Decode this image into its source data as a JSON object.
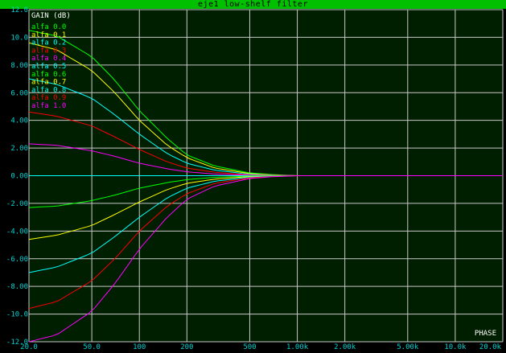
{
  "window": {
    "title": "eje1 low-shelf filter"
  },
  "chart_data": {
    "type": "line",
    "title": "eje1 low-shelf filter",
    "ylabel": "GAIN (dB)",
    "corner_label": "PHASE",
    "x_scale": "log",
    "xlim": [
      20,
      20000
    ],
    "ylim": [
      -12,
      12
    ],
    "grid": true,
    "legend_placement": "top-left",
    "x_ticks": [
      {
        "v": 20,
        "label": "20.0"
      },
      {
        "v": 50,
        "label": "50.0"
      },
      {
        "v": 100,
        "label": "100"
      },
      {
        "v": 200,
        "label": "200"
      },
      {
        "v": 500,
        "label": "500"
      },
      {
        "v": 1000,
        "label": "1.00k"
      },
      {
        "v": 2000,
        "label": "2.00k"
      },
      {
        "v": 5000,
        "label": "5.00k"
      },
      {
        "v": 10000,
        "label": "10.0k"
      },
      {
        "v": 20000,
        "label": "20.0k"
      }
    ],
    "y_ticks": [
      {
        "v": 12,
        "label": "12.0"
      },
      {
        "v": 10,
        "label": "10.0"
      },
      {
        "v": 8,
        "label": "8.00"
      },
      {
        "v": 6,
        "label": "6.00"
      },
      {
        "v": 4,
        "label": "4.00"
      },
      {
        "v": 2,
        "label": "2.00"
      },
      {
        "v": 0,
        "label": "0.00"
      },
      {
        "v": -2,
        "label": "-2.00"
      },
      {
        "v": -4,
        "label": "-4.00"
      },
      {
        "v": -6,
        "label": "-6.00"
      },
      {
        "v": -8,
        "label": "-8.00"
      },
      {
        "v": -10,
        "label": "-10.0"
      },
      {
        "v": -12,
        "label": "-12.0"
      }
    ],
    "x": [
      20,
      30,
      50,
      70,
      100,
      150,
      200,
      300,
      500,
      700,
      1000,
      2000,
      5000,
      10000,
      20000
    ],
    "series": [
      {
        "name": "alfa 0.0",
        "color": "#00ff00",
        "values": [
          10.5,
          10.1,
          8.6,
          6.9,
          4.7,
          2.7,
          1.5,
          0.7,
          0.2,
          0.08,
          0,
          0,
          0,
          0,
          0
        ]
      },
      {
        "name": "alfa 0.1",
        "color": "#ffff00",
        "values": [
          9.6,
          9.1,
          7.6,
          6.0,
          4.0,
          2.2,
          1.3,
          0.55,
          0.15,
          0.05,
          0,
          0,
          0,
          0,
          0
        ]
      },
      {
        "name": "alfa 0.2",
        "color": "#00ffff",
        "values": [
          7.0,
          6.6,
          5.6,
          4.4,
          3.0,
          1.6,
          0.9,
          0.4,
          0.1,
          0.03,
          0,
          0,
          0,
          0,
          0
        ]
      },
      {
        "name": "alfa 0.3",
        "color": "#ff0000",
        "values": [
          4.6,
          4.3,
          3.6,
          2.8,
          1.9,
          1.0,
          0.55,
          0.25,
          0.06,
          0.02,
          0,
          0,
          0,
          0,
          0
        ]
      },
      {
        "name": "alfa 0.4",
        "color": "#ff00ff",
        "values": [
          2.3,
          2.2,
          1.8,
          1.4,
          0.9,
          0.5,
          0.28,
          0.12,
          0.03,
          0.01,
          0,
          0,
          0,
          0,
          0
        ]
      },
      {
        "name": "alfa 0.5",
        "color": "#00ffff",
        "values": [
          0,
          0,
          0,
          0,
          0,
          0,
          0,
          0,
          0,
          0,
          0,
          0,
          0,
          0,
          0
        ]
      },
      {
        "name": "alfa 0.6",
        "color": "#00ff00",
        "values": [
          -2.3,
          -2.2,
          -1.8,
          -1.4,
          -0.9,
          -0.5,
          -0.28,
          -0.12,
          -0.03,
          -0.01,
          0,
          0,
          0,
          0,
          0
        ]
      },
      {
        "name": "alfa 0.7",
        "color": "#ffff00",
        "values": [
          -4.6,
          -4.3,
          -3.6,
          -2.8,
          -1.9,
          -1.0,
          -0.55,
          -0.25,
          -0.06,
          -0.02,
          0,
          0,
          0,
          0,
          0
        ]
      },
      {
        "name": "alfa 0.8",
        "color": "#00ffff",
        "values": [
          -7.0,
          -6.6,
          -5.6,
          -4.4,
          -3.0,
          -1.6,
          -0.9,
          -0.4,
          -0.1,
          -0.03,
          0,
          0,
          0,
          0,
          0
        ]
      },
      {
        "name": "alfa 0.9",
        "color": "#ff0000",
        "values": [
          -9.6,
          -9.1,
          -7.6,
          -6.0,
          -4.0,
          -2.2,
          -1.3,
          -0.55,
          -0.15,
          -0.05,
          0,
          0,
          0,
          0,
          0
        ]
      },
      {
        "name": "alfa 1.0",
        "color": "#ff00ff",
        "values": [
          -12.0,
          -11.5,
          -9.8,
          -7.8,
          -5.3,
          -3.0,
          -1.7,
          -0.75,
          -0.2,
          -0.07,
          0,
          0,
          0,
          0,
          0
        ]
      }
    ],
    "colors": {
      "background": "#001f00",
      "grid": "#c8c8c8",
      "tick_labels": "#00d2d2",
      "title_bar": "#00c000"
    }
  }
}
